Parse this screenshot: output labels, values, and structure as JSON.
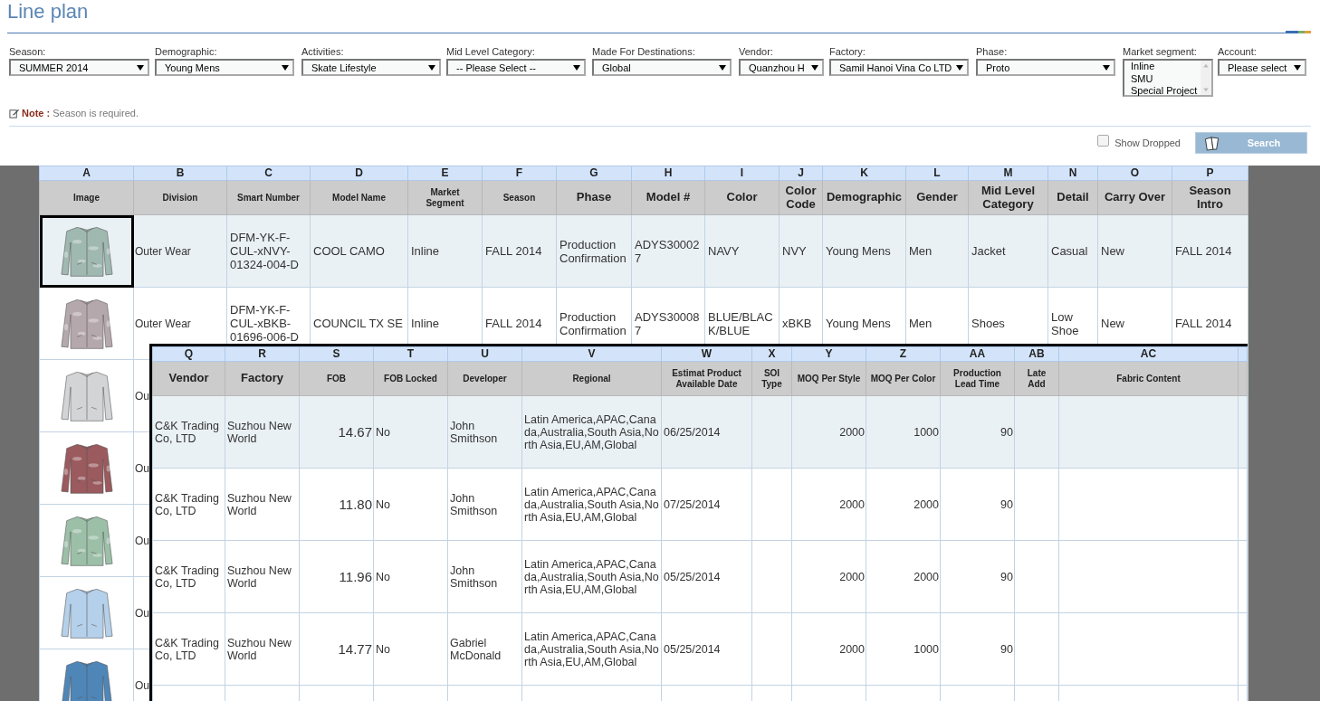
{
  "page_title": "Line plan",
  "filters": [
    {
      "kind": "select",
      "label": "Season:",
      "value": "SUMMER 2014"
    },
    {
      "kind": "select",
      "label": "Demographic:",
      "value": "Young Mens"
    },
    {
      "kind": "select",
      "label": "Activities:",
      "value": "Skate Lifestyle"
    },
    {
      "kind": "select",
      "label": "Mid Level Category:",
      "value": "-- Please Select --"
    },
    {
      "kind": "select",
      "label": "Made For Destinations:",
      "value": "Global"
    },
    {
      "kind": "select",
      "label": "Vendor:",
      "value": "Quanzhou H"
    },
    {
      "kind": "select",
      "label": "Factory:",
      "value": "Samil Hanoi Vina Co LTD"
    },
    {
      "kind": "select",
      "label": "Phase:",
      "value": "Proto"
    },
    {
      "kind": "listbox",
      "label": "Market segment:",
      "options": [
        {
          "label": "Inline",
          "selected": false
        },
        {
          "label": "SMU",
          "selected": false
        },
        {
          "label": "Special Project",
          "selected": false
        }
      ]
    },
    {
      "kind": "select",
      "label": "Account:",
      "value": "Please select"
    }
  ],
  "note": {
    "label": "Note :",
    "text": "Season is required."
  },
  "show_dropped": {
    "label": "Show Dropped",
    "checked": false
  },
  "search_button": "Search",
  "main_sheet": {
    "columns": [
      {
        "letter": "A",
        "header": "Image",
        "kind": "small"
      },
      {
        "letter": "B",
        "header": "Division",
        "kind": "small"
      },
      {
        "letter": "C",
        "header": "Smart Number",
        "kind": "small"
      },
      {
        "letter": "D",
        "header": "Model Name",
        "kind": "small"
      },
      {
        "letter": "E",
        "header": "Market Segment",
        "kind": "small"
      },
      {
        "letter": "F",
        "header": "Season",
        "kind": "small"
      },
      {
        "letter": "G",
        "header": "Phase",
        "kind": "large"
      },
      {
        "letter": "H",
        "header": "Model #",
        "kind": "large"
      },
      {
        "letter": "I",
        "header": "Color",
        "kind": "large"
      },
      {
        "letter": "J",
        "header": "Color Code",
        "kind": "large"
      },
      {
        "letter": "K",
        "header": "Demographic",
        "kind": "large"
      },
      {
        "letter": "L",
        "header": "Gender",
        "kind": "large"
      },
      {
        "letter": "M",
        "header": "Mid Level Category",
        "kind": "large"
      },
      {
        "letter": "N",
        "header": "Detail",
        "kind": "large"
      },
      {
        "letter": "O",
        "header": "Carry Over",
        "kind": "large"
      },
      {
        "letter": "P",
        "header": "Season Intro",
        "kind": "large"
      }
    ],
    "rows": [
      {
        "selected": true,
        "color": "#9fb8b0",
        "kind": "camo",
        "cells": [
          null,
          "Outer Wear",
          "DFM-YK-F-CUL-xNVY-01324-004-D",
          "COOL CAMO",
          "Inline",
          "FALL 2014",
          "Production Confirmation",
          "ADYS300027",
          "NAVY",
          "NVY",
          "Young Mens",
          "Men",
          "Jacket",
          "Casual",
          "New",
          "FALL 2014"
        ]
      },
      {
        "selected": false,
        "color": "#b5a8ad",
        "kind": "camo",
        "cells": [
          null,
          "Outer Wear",
          "DFM-YK-F-CUL-xBKB-01696-006-D",
          "COUNCIL TX SE",
          "Inline",
          "FALL 2014",
          "Production Confirmation",
          "ADYS300087",
          "BLUE/BLACK/BLUE",
          "xBKB",
          "Young Mens",
          "Men",
          "Shoes",
          "Low Shoe",
          "New",
          "FALL 2014"
        ]
      },
      {
        "selected": false,
        "color": "#d2d4d6",
        "kind": "plain",
        "cells": [
          null,
          "Ou"
        ]
      },
      {
        "selected": false,
        "color": "#9a5a5e",
        "kind": "camo",
        "cells": [
          null,
          "Ou"
        ]
      },
      {
        "selected": false,
        "color": "#9cbfa8",
        "kind": "camo",
        "cells": [
          null,
          "Ou"
        ]
      },
      {
        "selected": false,
        "color": "#b4d0ea",
        "kind": "plain",
        "cells": [
          null,
          "Ou"
        ]
      },
      {
        "selected": false,
        "color": "#4f86b8",
        "kind": "plain",
        "cells": [
          null,
          "Ou"
        ]
      }
    ]
  },
  "detail_sheet": {
    "columns": [
      {
        "letter": "Q",
        "header": "Vendor",
        "kind": "large"
      },
      {
        "letter": "R",
        "header": "Factory",
        "kind": "large"
      },
      {
        "letter": "S",
        "header": "FOB",
        "kind": "number"
      },
      {
        "letter": "T",
        "header": "FOB Locked",
        "kind": "small"
      },
      {
        "letter": "U",
        "header": "Developer",
        "kind": "small"
      },
      {
        "letter": "V",
        "header": "Regional",
        "kind": "small"
      },
      {
        "letter": "W",
        "header": "Estimat Product Available Date",
        "kind": "small"
      },
      {
        "letter": "X",
        "header": "SOI Type",
        "kind": "small"
      },
      {
        "letter": "Y",
        "header": "MOQ Per Style",
        "kind": "number"
      },
      {
        "letter": "Z",
        "header": "MOQ Per Color",
        "kind": "number"
      },
      {
        "letter": "AA",
        "header": "Production Lead Time",
        "kind": "number"
      },
      {
        "letter": "AB",
        "header": "Late Add",
        "kind": "small"
      },
      {
        "letter": "AC",
        "header": "Fabric Content",
        "kind": "small"
      }
    ],
    "rows": [
      {
        "selected": true,
        "cells": [
          "C&K Trading Co, LTD",
          "Suzhou New World",
          "14.67",
          "No",
          "John Smithson",
          "Latin America,APAC,Canada,Australia,South Asia,North Asia,EU,AM,Global",
          "06/25/2014",
          null,
          "2000",
          "1000",
          "90"
        ]
      },
      {
        "selected": false,
        "cells": [
          "C&K Trading Co, LTD",
          "Suzhou New World",
          "11.80",
          "No",
          "John Smithson",
          "Latin America,APAC,Canada,Australia,South Asia,North Asia,EU,AM,Global",
          "07/25/2014",
          null,
          "2000",
          "2000",
          "90"
        ]
      },
      {
        "selected": false,
        "cells": [
          "C&K Trading Co, LTD",
          "Suzhou New World",
          "11.96",
          "No",
          "John Smithson",
          "Latin America,APAC,Canada,Australia,South Asia,North Asia,EU,AM,Global",
          "05/25/2014",
          null,
          "2000",
          "2000",
          "90"
        ]
      },
      {
        "selected": false,
        "cells": [
          "C&K Trading Co, LTD",
          "Suzhou New World",
          "14.77",
          "No",
          "Gabriel McDonald",
          "Latin America,APAC,Canada,Australia,South Asia,North Asia,EU,AM,Global",
          "05/25/2014",
          null,
          "2000",
          "1000",
          "90"
        ]
      }
    ]
  }
}
